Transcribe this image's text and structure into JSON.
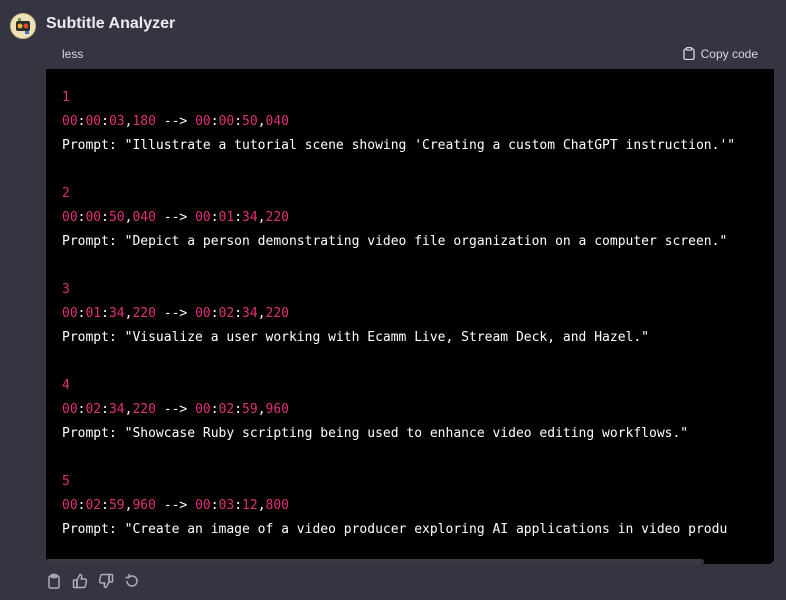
{
  "message": {
    "sender": "Subtitle Analyzer"
  },
  "code_block": {
    "language": "less",
    "copy_label": "Copy code",
    "entries": [
      {
        "index": "1",
        "start": [
          "00",
          "00",
          "03",
          "180"
        ],
        "end": [
          "00",
          "00",
          "50",
          "040"
        ],
        "prompt": "Prompt: \"Illustrate a tutorial scene showing 'Creating a custom ChatGPT instruction.'\""
      },
      {
        "index": "2",
        "start": [
          "00",
          "00",
          "50",
          "040"
        ],
        "end": [
          "00",
          "01",
          "34",
          "220"
        ],
        "prompt": "Prompt: \"Depict a person demonstrating video file organization on a computer screen.\""
      },
      {
        "index": "3",
        "start": [
          "00",
          "01",
          "34",
          "220"
        ],
        "end": [
          "00",
          "02",
          "34",
          "220"
        ],
        "prompt": "Prompt: \"Visualize a user working with Ecamm Live, Stream Deck, and Hazel.\""
      },
      {
        "index": "4",
        "start": [
          "00",
          "02",
          "34",
          "220"
        ],
        "end": [
          "00",
          "02",
          "59",
          "960"
        ],
        "prompt": "Prompt: \"Showcase Ruby scripting being used to enhance video editing workflows.\""
      },
      {
        "index": "5",
        "start": [
          "00",
          "02",
          "59",
          "960"
        ],
        "end": [
          "00",
          "03",
          "12",
          "800"
        ],
        "prompt": "Prompt: \"Create an image of a video producer exploring AI applications in video produ"
      }
    ]
  },
  "actions": [
    {
      "name": "copy-icon"
    },
    {
      "name": "thumbs-up-icon"
    },
    {
      "name": "thumbs-down-icon"
    },
    {
      "name": "regenerate-icon"
    }
  ],
  "colors": {
    "background": "#343541",
    "code_background": "#000000",
    "number_color": "#df3079"
  }
}
